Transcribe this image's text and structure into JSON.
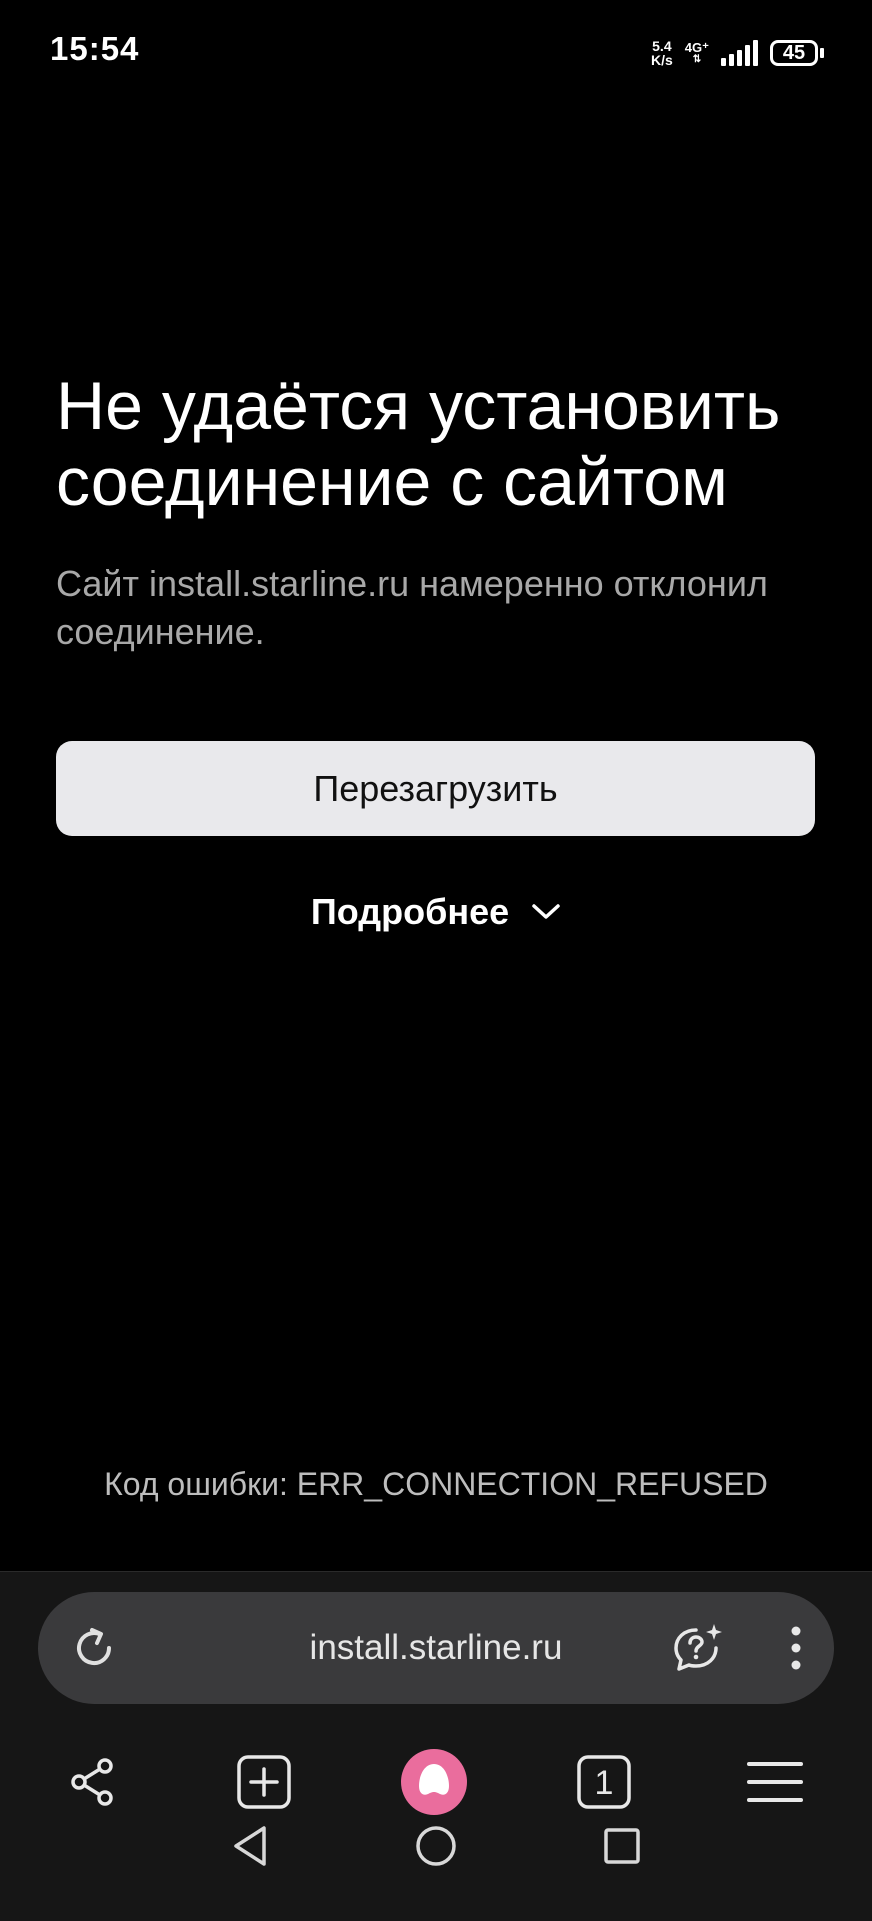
{
  "status_bar": {
    "time": "15:54",
    "net_speed_value": "5.4",
    "net_speed_unit": "K/s",
    "network_type": "4G⁺",
    "battery_level": "45"
  },
  "error_page": {
    "title": "Не удаётся установить соединение с сайтом",
    "description": "Сайт install.starline.ru намеренно отклонил соединение.",
    "reload_label": "Перезагрузить",
    "details_label": "Подробнее",
    "error_code": "Код ошибки: ERR_CONNECTION_REFUSED"
  },
  "address_bar": {
    "url": "install.starline.ru"
  },
  "toolbar": {
    "tabs_count": "1",
    "icons": [
      "share-icon",
      "new-tab-icon",
      "alice-assistant-icon",
      "tabs-icon",
      "menu-icon"
    ]
  },
  "colors": {
    "background": "#000000",
    "button_bg": "#e9e9ec",
    "url_bar_bg": "#3a3a3c",
    "panel_bg": "#161616",
    "assistant_accent": "#ea6d9d"
  }
}
